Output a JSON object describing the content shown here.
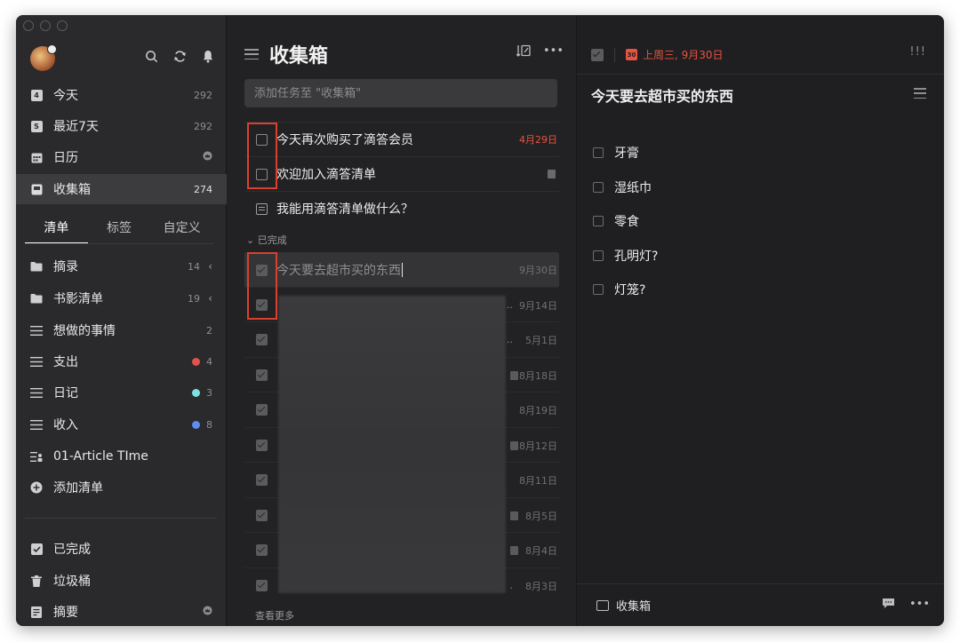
{
  "sidebar": {
    "nav": [
      {
        "label": "今天",
        "count": "292",
        "icon": "calendar-today-icon"
      },
      {
        "label": "最近7天",
        "count": "292",
        "icon": "calendar-week-icon"
      },
      {
        "label": "日历",
        "count": "",
        "icon": "calendar-grid-icon"
      },
      {
        "label": "收集箱",
        "count": "274",
        "icon": "inbox-icon"
      }
    ],
    "tabs": [
      "清单",
      "标签",
      "自定义"
    ],
    "lists": [
      {
        "label": "摘录",
        "count": "14"
      },
      {
        "label": "书影清单",
        "count": "19"
      },
      {
        "label": "想做的事情",
        "count": "2"
      },
      {
        "label": "支出",
        "count": "4",
        "color": "#e0544a"
      },
      {
        "label": "日记",
        "count": "3",
        "color": "#7fe0e0"
      },
      {
        "label": "收入",
        "count": "8",
        "color": "#5b8ef0"
      },
      {
        "label": "01-Article TIme",
        "count": ""
      },
      {
        "label": "添加清单",
        "count": ""
      }
    ],
    "bottom": [
      {
        "label": "已完成"
      },
      {
        "label": "垃圾桶"
      },
      {
        "label": "摘要"
      }
    ]
  },
  "middle": {
    "title": "收集箱",
    "add_placeholder": "添加任务至 \"收集箱\"",
    "tasks": [
      {
        "title": "今天再次购买了滴答会员",
        "date": "4月29日"
      },
      {
        "title": "欢迎加入滴答清单",
        "date": ""
      },
      {
        "title": "我能用滴答清单做什么？",
        "date": ""
      }
    ],
    "completed_header": "已完成",
    "completed": [
      {
        "title": "今天要去超市买的东西",
        "date": "9月30日"
      },
      {
        "title": "",
        "date": "9月14日"
      },
      {
        "title": "",
        "date": "5月1日"
      },
      {
        "title": "",
        "date": "8月18日"
      },
      {
        "title": "",
        "date": "8月19日"
      },
      {
        "title": "",
        "date": "8月12日"
      },
      {
        "title": "",
        "date": "8月11日"
      },
      {
        "title": "",
        "date": "8月5日"
      },
      {
        "title": "",
        "date": "8月4日"
      },
      {
        "title": "",
        "date": "8月3日"
      }
    ],
    "more": "查看更多"
  },
  "detail": {
    "date": "上周三, 9月30日",
    "calendar_day": "30",
    "priority": "!!!",
    "title": "今天要去超市买的东西",
    "subtasks": [
      "牙膏",
      "湿纸巾",
      "零食",
      "孔明灯?",
      "灯笼?"
    ],
    "footer_list": "收集箱"
  },
  "colors": {
    "accent_red": "#e8523f",
    "highlight_box": "#d9412c"
  }
}
